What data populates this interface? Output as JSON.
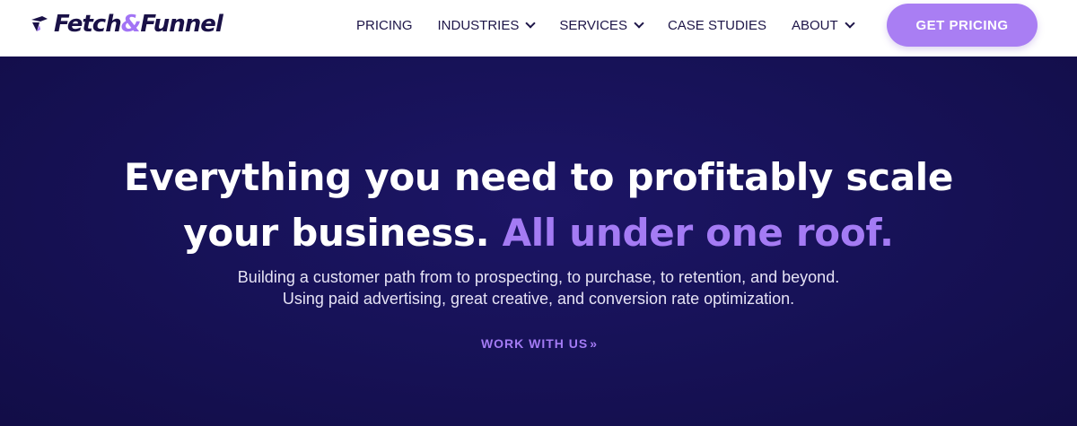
{
  "header": {
    "logo": {
      "part1": "Fetch",
      "amp": "&",
      "part2": "Funnel"
    },
    "nav": [
      {
        "label": "PRICING",
        "has_dropdown": false
      },
      {
        "label": "INDUSTRIES",
        "has_dropdown": true
      },
      {
        "label": "SERVICES",
        "has_dropdown": true
      },
      {
        "label": "CASE STUDIES",
        "has_dropdown": false
      },
      {
        "label": "ABOUT",
        "has_dropdown": true
      }
    ],
    "cta_label": "GET PRICING"
  },
  "hero": {
    "headline_line1": "Everything you need to profitably scale",
    "headline_line2_plain": "your business.",
    "headline_line2_accent": "All under one roof.",
    "subtext_line1": "Building a customer path from to prospecting, to purchase, to retention, and beyond.",
    "subtext_line2": "Using paid advertising, great creative, and conversion rate optimization.",
    "link_label": "WORK WITH US",
    "link_arrows": "»"
  },
  "colors": {
    "brand_dark": "#1a1147",
    "accent_purple": "#a47bf4",
    "cta_background": "#a97ef3",
    "hero_background": "#171258"
  },
  "icons": {
    "logo_mark": "fetch-funnel-logo-mark",
    "nav_dropdown": "chevron-down-icon",
    "link_arrow": "double-chevron-right-icon"
  }
}
